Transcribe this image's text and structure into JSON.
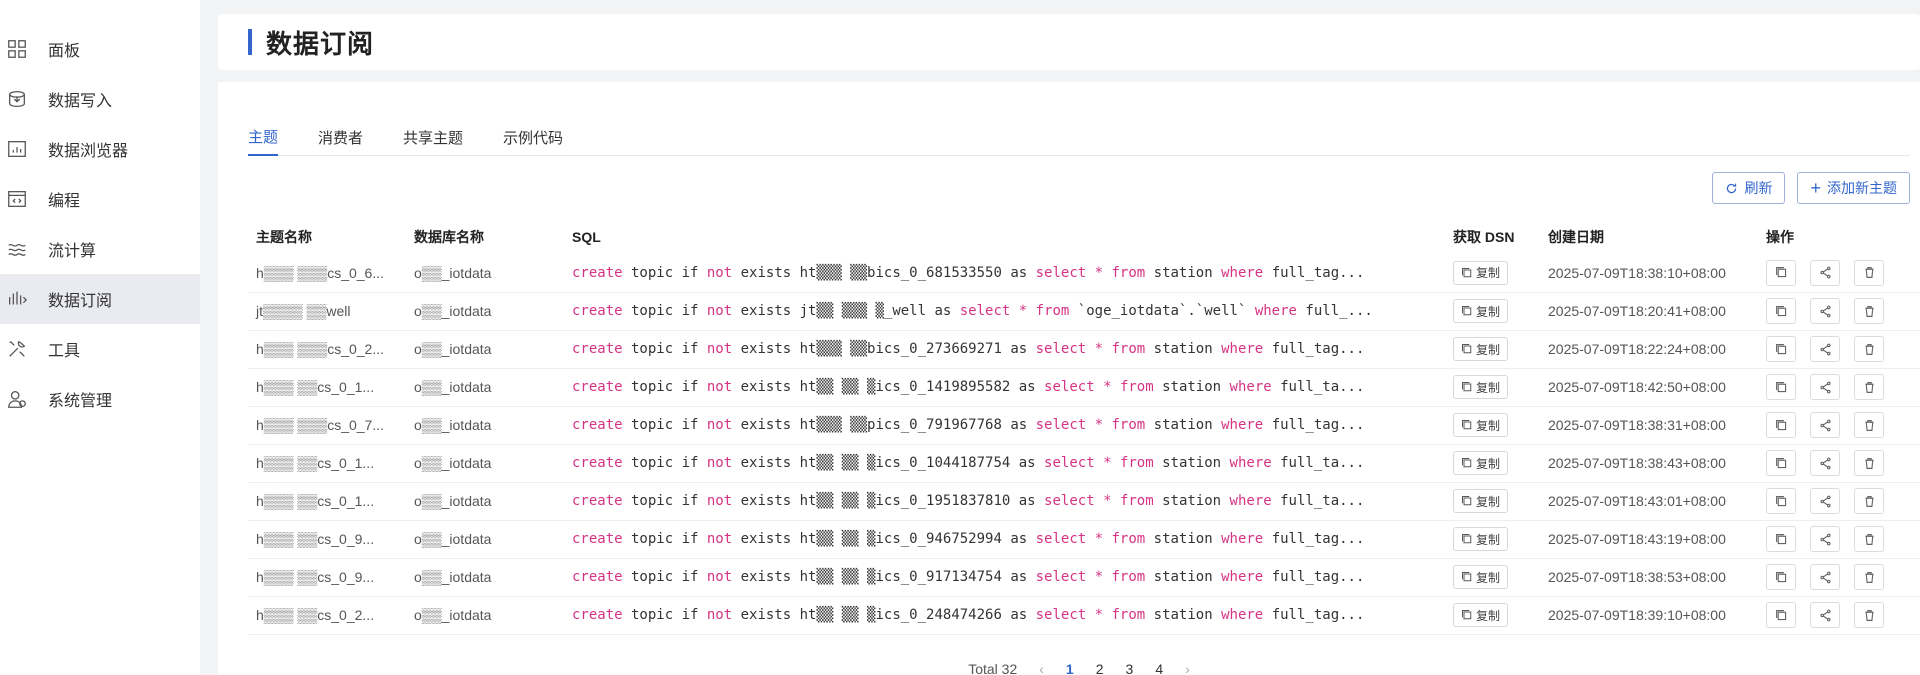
{
  "sidebar": {
    "items": [
      {
        "label": "面板",
        "icon": "dashboard-icon"
      },
      {
        "label": "数据写入",
        "icon": "data-write-icon"
      },
      {
        "label": "数据浏览器",
        "icon": "data-browser-icon"
      },
      {
        "label": "编程",
        "icon": "code-icon"
      },
      {
        "label": "流计算",
        "icon": "stream-icon"
      },
      {
        "label": "数据订阅",
        "icon": "subscription-icon",
        "active": true
      },
      {
        "label": "工具",
        "icon": "tools-icon"
      },
      {
        "label": "系统管理",
        "icon": "user-admin-icon"
      }
    ]
  },
  "header": {
    "title": "数据订阅"
  },
  "tabs": [
    {
      "label": "主题",
      "active": true
    },
    {
      "label": "消费者"
    },
    {
      "label": "共享主题"
    },
    {
      "label": "示例代码"
    }
  ],
  "toolbar": {
    "refresh_label": "刷新",
    "add_label": "添加新主题"
  },
  "table": {
    "columns": {
      "topic": "主题名称",
      "db": "数据库名称",
      "sql": "SQL",
      "dsn": "获取 DSN",
      "created": "创建日期",
      "ops": "操作"
    },
    "copy_label": "复制",
    "rows": [
      {
        "topic": "h▒▒▒ ▒▒▒cs_0_6...",
        "db": "o▒▒_iotdata",
        "sql_pre": "create topic if not exists ht▒▒▒ ▒▒bics_0_681533550 as select * from station",
        "sql_kw": "where",
        "sql_post": "full_tag...",
        "created": "2025-07-09T18:38:10+08:00"
      },
      {
        "topic": "jt▒▒▒▒ ▒▒well",
        "db": "o▒▒_iotdata",
        "sql_pre": "create topic if not exists jt▒▒ ▒▒▒ ▒_well as select * from `oge_iotdata`.`well`",
        "sql_kw": "where",
        "sql_post": "full_...",
        "created": "2025-07-09T18:20:41+08:00"
      },
      {
        "topic": "h▒▒▒ ▒▒▒cs_0_2...",
        "db": "o▒▒_iotdata",
        "sql_pre": "create topic if not exists ht▒▒▒ ▒▒bics_0_273669271 as select * from station",
        "sql_kw": "where",
        "sql_post": "full_tag...",
        "created": "2025-07-09T18:22:24+08:00"
      },
      {
        "topic": "h▒▒▒ ▒▒cs_0_1...",
        "db": "o▒▒_iotdata",
        "sql_pre": "create topic if not exists ht▒▒ ▒▒ ▒ics_0_1419895582 as select * from station",
        "sql_kw": "where",
        "sql_post": "full_ta...",
        "created": "2025-07-09T18:42:50+08:00"
      },
      {
        "topic": "h▒▒▒ ▒▒▒cs_0_7...",
        "db": "o▒▒_iotdata",
        "sql_pre": "create topic if not exists ht▒▒▒ ▒▒pics_0_791967768 as select * from station",
        "sql_kw": "where",
        "sql_post": "full_tag...",
        "created": "2025-07-09T18:38:31+08:00"
      },
      {
        "topic": "h▒▒▒ ▒▒cs_0_1...",
        "db": "o▒▒_iotdata",
        "sql_pre": "create topic if not exists ht▒▒ ▒▒ ▒ics_0_1044187754 as select * from station",
        "sql_kw": "where",
        "sql_post": "full_ta...",
        "created": "2025-07-09T18:38:43+08:00"
      },
      {
        "topic": "h▒▒▒ ▒▒cs_0_1...",
        "db": "o▒▒_iotdata",
        "sql_pre": "create topic if not exists ht▒▒ ▒▒ ▒ics_0_1951837810 as select * from station",
        "sql_kw": "where",
        "sql_post": "full_ta...",
        "created": "2025-07-09T18:43:01+08:00"
      },
      {
        "topic": "h▒▒▒ ▒▒cs_0_9...",
        "db": "o▒▒_iotdata",
        "sql_pre": "create topic if not exists ht▒▒ ▒▒ ▒ics_0_946752994 as select * from station",
        "sql_kw": "where",
        "sql_post": "full_tag...",
        "created": "2025-07-09T18:43:19+08:00"
      },
      {
        "topic": "h▒▒▒ ▒▒cs_0_9...",
        "db": "o▒▒_iotdata",
        "sql_pre": "create topic if not exists ht▒▒ ▒▒ ▒ics_0_917134754 as select * from station",
        "sql_kw": "where",
        "sql_post": "full_tag...",
        "created": "2025-07-09T18:38:53+08:00"
      },
      {
        "topic": "h▒▒▒ ▒▒cs_0_2...",
        "db": "o▒▒_iotdata",
        "sql_pre": "create topic if not exists ht▒▒ ▒▒ ▒ics_0_248474266 as select * from station",
        "sql_kw": "where",
        "sql_post": "full_tag...",
        "created": "2025-07-09T18:39:10+08:00"
      }
    ]
  },
  "pagination": {
    "total_label": "Total 32",
    "pages": [
      "1",
      "2",
      "3",
      "4"
    ],
    "current": "1"
  },
  "colors": {
    "accent": "#3366cc",
    "keyword": "#d63384"
  }
}
